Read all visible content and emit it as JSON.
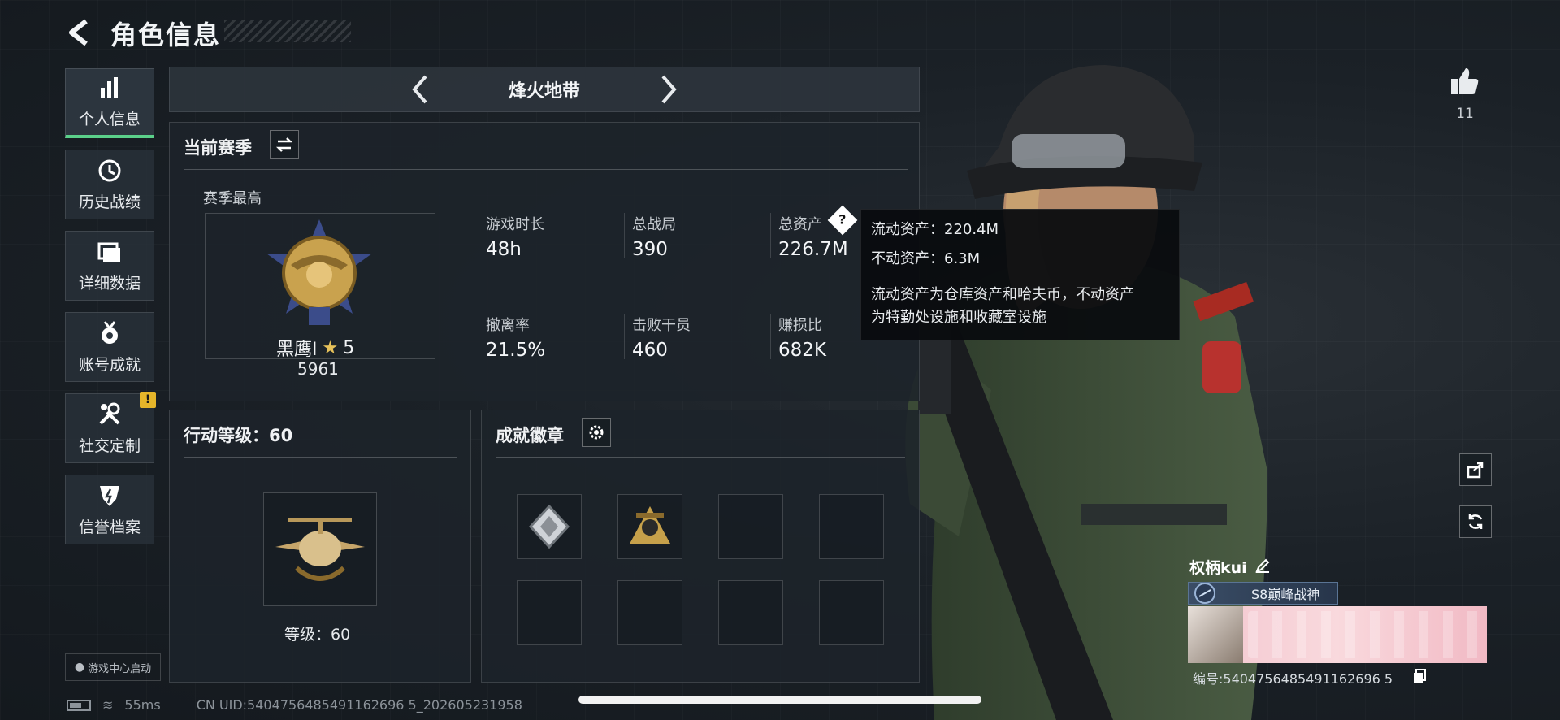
{
  "header": {
    "title": "角色信息"
  },
  "sidebar": {
    "items": [
      {
        "label": "个人信息",
        "icon": "bar-chart-icon",
        "active": true
      },
      {
        "label": "历史战绩",
        "icon": "history-clock-icon"
      },
      {
        "label": "详细数据",
        "icon": "folder-data-icon"
      },
      {
        "label": "账号成就",
        "icon": "medal-icon"
      },
      {
        "label": "社交定制",
        "icon": "wrench-icon",
        "badge": "!"
      },
      {
        "label": "信誉档案",
        "icon": "shield-lightning-icon"
      }
    ],
    "game_center_label": "游戏中心启动"
  },
  "mode_selector": {
    "label": "烽火地带"
  },
  "season": {
    "title": "当前赛季",
    "best_label": "赛季最高",
    "rank_name": "黑鹰I",
    "rank_stars": "5",
    "rank_score": "5961",
    "stats": [
      {
        "label": "游戏时长",
        "value": "48h"
      },
      {
        "label": "总战局",
        "value": "390"
      },
      {
        "label": "总资产",
        "value": "226.7M",
        "has_help": true
      },
      {
        "label": "撤离率",
        "value": "21.5%"
      },
      {
        "label": "击败干员",
        "value": "460"
      },
      {
        "label": "赚损比",
        "value": "682K"
      }
    ]
  },
  "tooltip": {
    "line1": "流动资产：220.4M",
    "line2": "不动资产：6.3M",
    "desc1": "流动资产为仓库资产和哈夫币，不动资产",
    "desc2": "为特勤处设施和收藏室设施"
  },
  "action_level": {
    "title": "行动等级：60",
    "level_text": "等级：60"
  },
  "achievements": {
    "title": "成就徽章",
    "filled_slots": 2,
    "total_slots": 8
  },
  "profile": {
    "likes": "11",
    "player_name": "权柄kui",
    "title_tag": "S8巅峰战神",
    "id_label": "编号:5404756485491162696 5"
  },
  "status": {
    "latency": "55ms",
    "uid_text": "CN UID:5404756485491162696 5_202605231958"
  },
  "colors": {
    "accent_green": "#5bd08a",
    "warning": "#e5b52a",
    "panel": "#1c232a"
  }
}
